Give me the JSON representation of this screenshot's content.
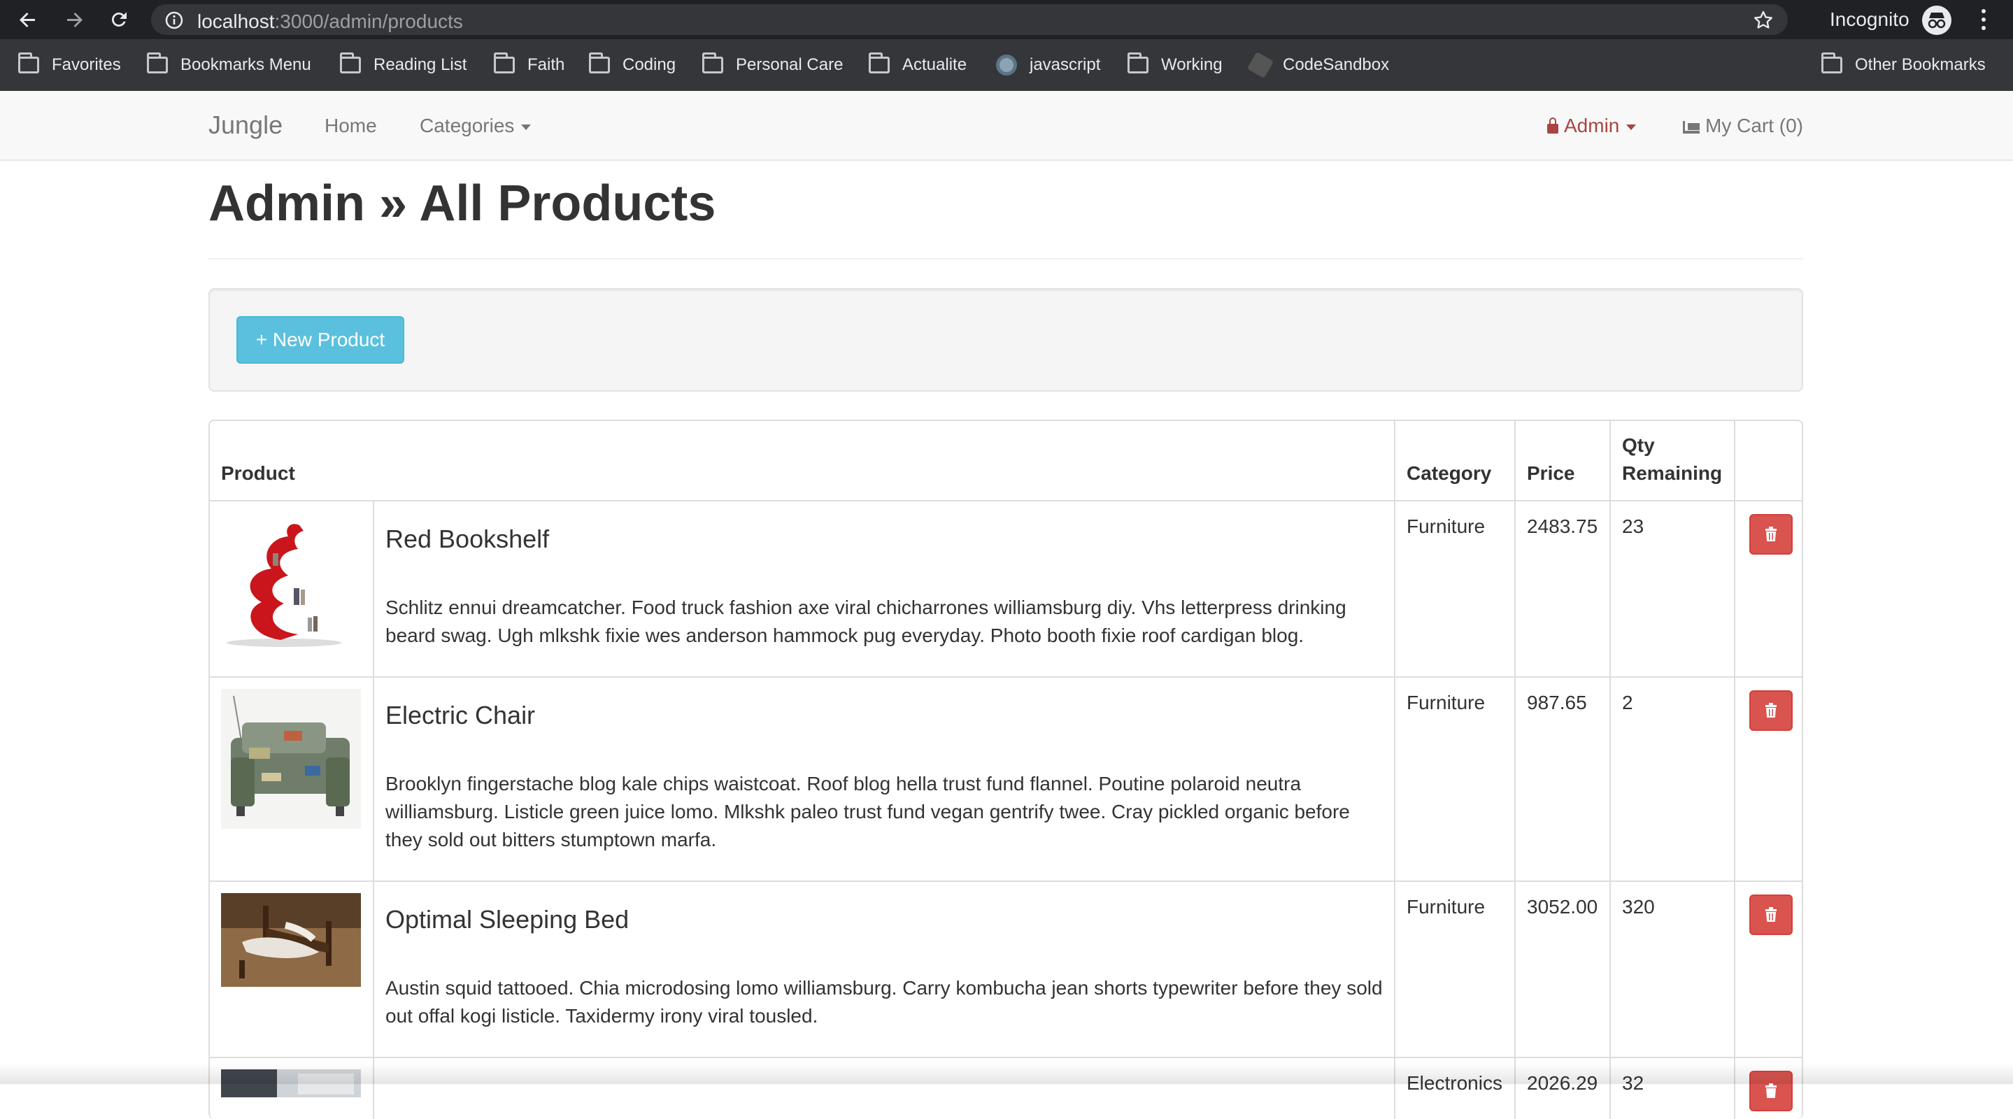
{
  "browser": {
    "url_host": "localhost",
    "url_rest": ":3000/admin/products",
    "incognito_label": "Incognito",
    "bookmarks": [
      {
        "label": "Favorites",
        "icon": "folder-icon"
      },
      {
        "label": "Bookmarks Menu",
        "icon": "folder-icon"
      },
      {
        "label": "Reading List",
        "icon": "folder-icon"
      },
      {
        "label": "Faith",
        "icon": "folder-icon"
      },
      {
        "label": "Coding",
        "icon": "folder-icon"
      },
      {
        "label": "Personal Care",
        "icon": "folder-icon"
      },
      {
        "label": "Actualite",
        "icon": "folder-icon"
      },
      {
        "label": "javascript",
        "icon": "site-icon"
      },
      {
        "label": "Working",
        "icon": "folder-icon"
      },
      {
        "label": "CodeSandbox",
        "icon": "codesandbox-icon"
      }
    ],
    "other_bookmarks": "Other Bookmarks"
  },
  "navbar": {
    "brand": "Jungle",
    "home": "Home",
    "categories": "Categories",
    "admin": "Admin",
    "cart": "My Cart (0)"
  },
  "page": {
    "title": "Admin » All Products",
    "new_product_button": "+ New Product"
  },
  "table": {
    "headers": {
      "product": "Product",
      "category": "Category",
      "price": "Price",
      "qty": "Qty Remaining"
    },
    "rows": [
      {
        "name": "Red Bookshelf",
        "description": "Schlitz ennui dreamcatcher. Food truck fashion axe viral chicharrones williamsburg diy. Vhs letterpress drinking beard swag. Ugh mlkshk fixie wes anderson hammock pug everyday. Photo booth fixie roof cardigan blog.",
        "category": "Furniture",
        "price": "2483.75",
        "qty": "23"
      },
      {
        "name": "Electric Chair",
        "description": "Brooklyn fingerstache blog kale chips waistcoat. Roof blog hella trust fund flannel. Poutine polaroid neutra williamsburg. Listicle green juice lomo. Mlkshk paleo trust fund vegan gentrify twee. Cray pickled organic before they sold out bitters stumptown marfa.",
        "category": "Furniture",
        "price": "987.65",
        "qty": "2"
      },
      {
        "name": "Optimal Sleeping Bed",
        "description": "Austin squid tattooed. Chia microdosing lomo williamsburg. Carry kombucha jean shorts typewriter before they sold out offal kogi listicle. Taxidermy irony viral tousled.",
        "category": "Furniture",
        "price": "3052.00",
        "qty": "320"
      },
      {
        "name": "",
        "description": "",
        "category": "Electronics",
        "price": "2026.29",
        "qty": "32"
      }
    ]
  }
}
